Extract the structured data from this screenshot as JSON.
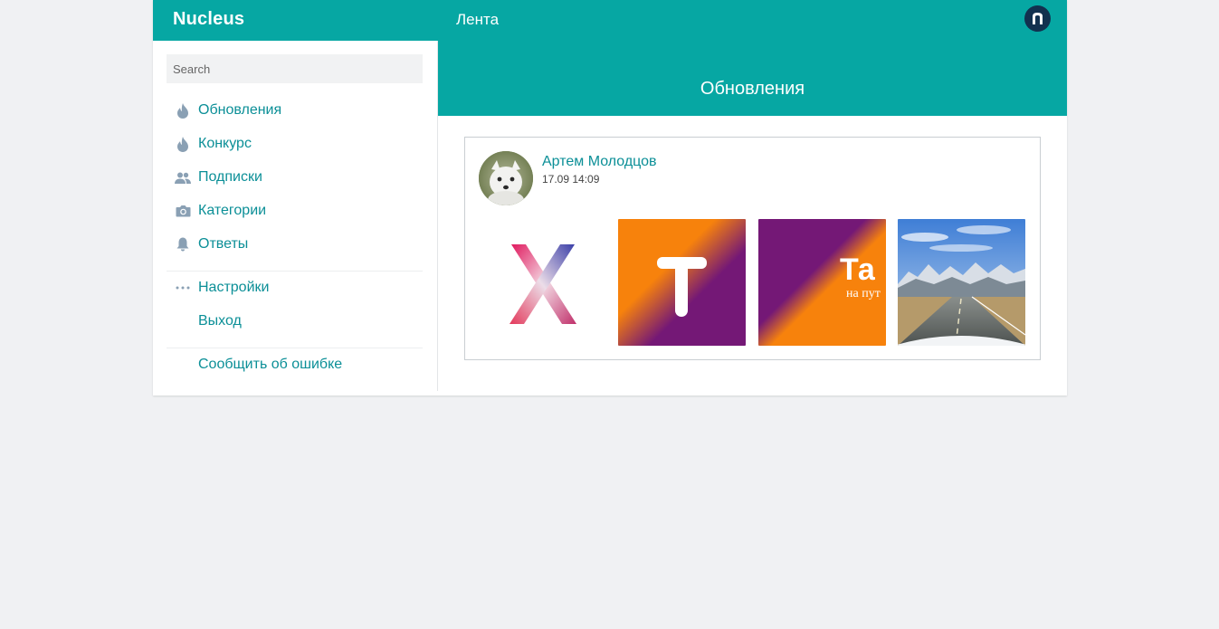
{
  "header": {
    "brand": "Nucleus",
    "nav_label": "Лента",
    "user_initial": "n"
  },
  "sidebar": {
    "search_placeholder": "Search",
    "items": [
      {
        "label": "Обновления",
        "icon": "flame-icon"
      },
      {
        "label": "Конкурс",
        "icon": "flame-icon"
      },
      {
        "label": "Подписки",
        "icon": "people-icon"
      },
      {
        "label": "Категории",
        "icon": "camera-icon"
      },
      {
        "label": "Ответы",
        "icon": "bell-icon"
      }
    ],
    "secondary": [
      {
        "label": "Настройки",
        "icon": "more-dots-icon"
      },
      {
        "label": "Выход",
        "icon": ""
      }
    ],
    "report": {
      "label": "Сообщить об ошибке"
    }
  },
  "main": {
    "title": "Обновления",
    "post": {
      "author": "Артем Молодцов",
      "date": "17.09 14:09",
      "thumbnails": [
        {
          "name": "x-logo-image",
          "letter": "X"
        },
        {
          "name": "t-logo-image",
          "letter": "T"
        },
        {
          "name": "travel-logo-image",
          "text": "Та",
          "subtext": "на пут"
        },
        {
          "name": "mountain-road-photo"
        }
      ]
    }
  },
  "colors": {
    "accent": "#06a7a3",
    "link": "#0b8f97",
    "badge": "#12314f",
    "icon": "#8aa0b4",
    "page_bg": "#f0f1f3"
  }
}
